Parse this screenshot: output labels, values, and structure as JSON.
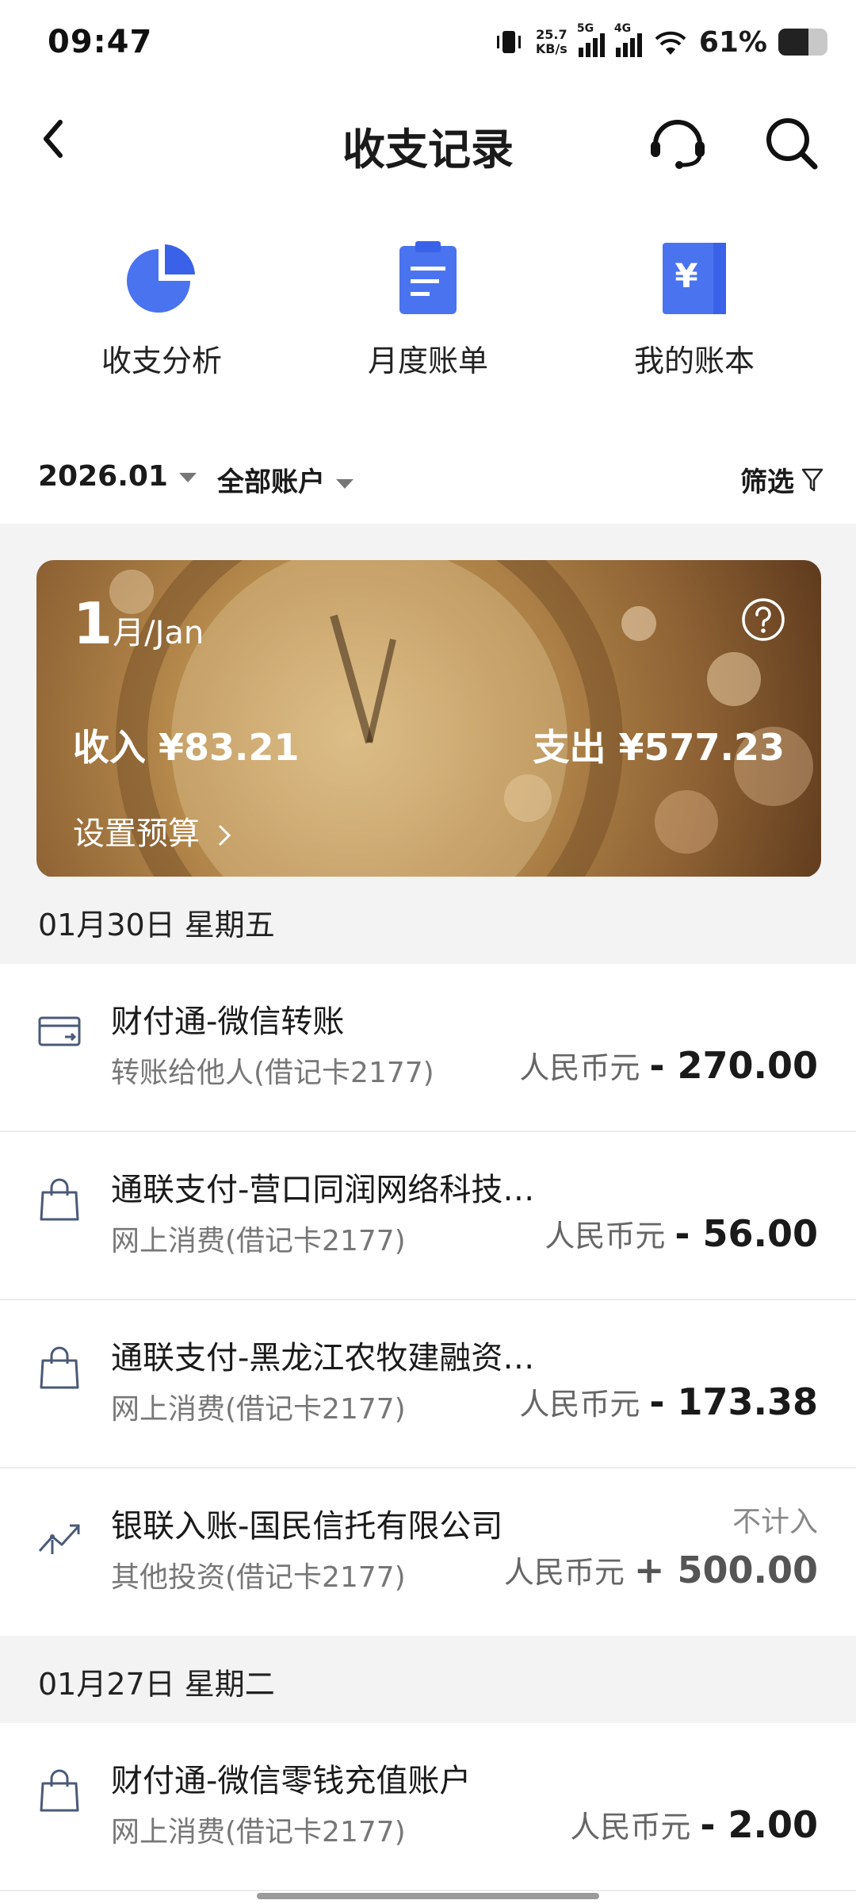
{
  "status_bar": {
    "time": "09:47",
    "speed_value": "25.7",
    "speed_unit": "KB/s",
    "sig1": "5G",
    "sig2": "4G",
    "battery": "61%"
  },
  "nav": {
    "title": "收支记录",
    "back_icon": "back-chevron-icon",
    "service_icon": "headset-icon",
    "search_icon": "search-icon"
  },
  "shortcuts": [
    {
      "label": "收支分析",
      "icon": "pie-chart-icon"
    },
    {
      "label": "月度账单",
      "icon": "bill-document-icon"
    },
    {
      "label": "我的账本",
      "icon": "yuan-ledger-icon"
    }
  ],
  "filters": {
    "month": "2026.01",
    "account": "全部账户",
    "filter": "筛选"
  },
  "banner": {
    "month_num": "1",
    "month_text": "月/Jan",
    "income": "收入 ¥83.21",
    "expense": "支出 ¥577.23",
    "budget": "设置预算"
  },
  "sections": [
    {
      "date": "01月30日 星期五",
      "transactions": [
        {
          "name": "财付通-微信转账",
          "sub": "转账给他人(借记卡2177)",
          "currency": "人民币元",
          "amount": "- 270.00",
          "icon": "card-transfer-icon"
        },
        {
          "name": "通联支付-营口同润网络科技…",
          "sub": "网上消费(借记卡2177)",
          "currency": "人民币元",
          "amount": "- 56.00",
          "icon": "shopping-bag-icon"
        },
        {
          "name": "通联支付-黑龙江农牧建融资…",
          "sub": "网上消费(借记卡2177)",
          "currency": "人民币元",
          "amount": "- 173.38",
          "icon": "shopping-bag-icon"
        },
        {
          "name": "银联入账-国民信托有限公司",
          "sub": "其他投资(借记卡2177)",
          "currency": "人民币元",
          "amount": "+ 500.00",
          "note": "不计入",
          "icon": "investment-trend-icon"
        }
      ]
    },
    {
      "date": "01月27日 星期二",
      "transactions": [
        {
          "name": "财付通-微信零钱充值账户",
          "sub": "网上消费(借记卡2177)",
          "currency": "人民币元",
          "amount": "- 2.00",
          "icon": "shopping-bag-icon"
        }
      ]
    }
  ]
}
